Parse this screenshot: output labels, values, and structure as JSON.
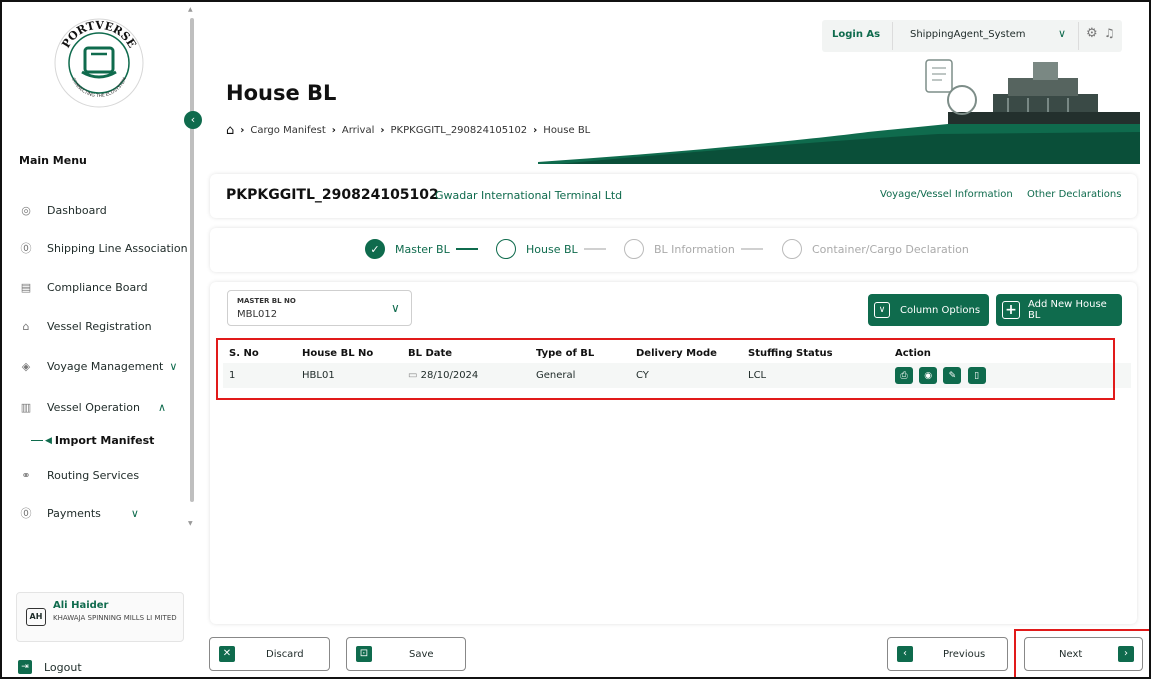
{
  "brand": {
    "logo_text": "PORTVERSE",
    "logo_tagline": "CONNECTING THE ECOSYSTEM",
    "accent": "#0f6b4d"
  },
  "topbar": {
    "login_as": "Login As",
    "agent": "ShippingAgent_System"
  },
  "sidebar": {
    "title": "Main Menu",
    "items": [
      {
        "label": "Dashboard",
        "icon": "dashboard-icon"
      },
      {
        "label": "Shipping Line Association",
        "icon": "association-icon"
      },
      {
        "label": "Compliance Board",
        "icon": "compliance-icon"
      },
      {
        "label": "Vessel Registration",
        "icon": "registration-icon"
      },
      {
        "label": "Voyage Management",
        "icon": "voyage-icon"
      },
      {
        "label": "Vessel Operation",
        "icon": "operation-icon"
      },
      {
        "label": "Routing Services",
        "icon": "routing-icon"
      },
      {
        "label": "Payments",
        "icon": "payments-icon"
      }
    ],
    "sub_item": "Import Manifest",
    "user": {
      "initials": "AH",
      "name": "Ali Haider",
      "org": "KHAWAJA SPINNING MILLS LI MITED"
    },
    "logout": "Logout"
  },
  "page": {
    "title": "House BL",
    "breadcrumb": [
      "Cargo Manifest",
      "Arrival",
      "PKPKGGITL_290824105102",
      "House BL"
    ]
  },
  "voyage": {
    "id": "PKPKGGITL_290824105102",
    "terminal": "Gwadar International Terminal Ltd",
    "link_voyage": "Voyage/Vessel Information",
    "link_other": "Other Declarations"
  },
  "steps": [
    {
      "label": "Master BL",
      "state": "done"
    },
    {
      "label": "House BL",
      "state": "current"
    },
    {
      "label": "BL Information",
      "state": "pending"
    },
    {
      "label": "Container/Cargo Declaration",
      "state": "pending"
    }
  ],
  "master_bl": {
    "label": "MASTER BL NO",
    "value": "MBL012"
  },
  "buttons": {
    "column_options": "Column Options",
    "add_house_bl": "Add New House BL",
    "discard": "Discard",
    "save": "Save",
    "previous": "Previous",
    "next": "Next"
  },
  "table": {
    "headers": [
      "S. No",
      "House BL No",
      "BL Date",
      "Type of BL",
      "Delivery Mode",
      "Stuffing Status",
      "Action"
    ],
    "rows": [
      {
        "sno": "1",
        "hbl": "HBL01",
        "date": "28/10/2024",
        "type": "General",
        "mode": "CY",
        "status": "LCL"
      }
    ],
    "actions": [
      "print-icon",
      "view-icon",
      "edit-icon",
      "delete-icon"
    ]
  }
}
